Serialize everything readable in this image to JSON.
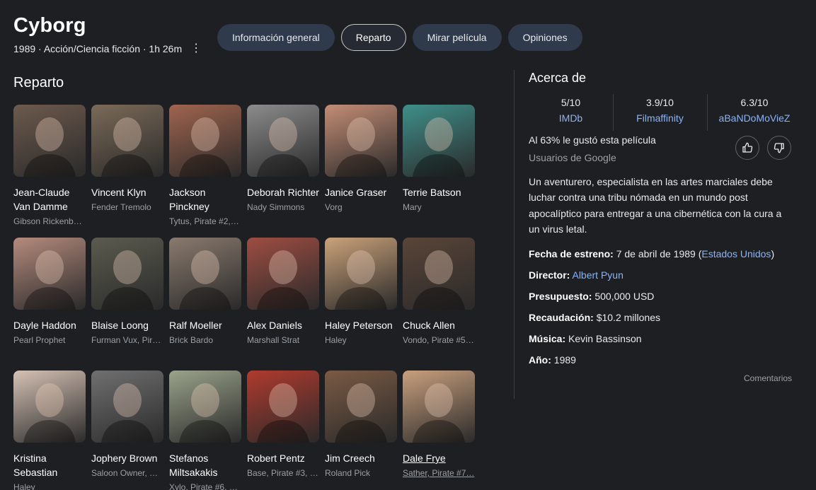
{
  "header": {
    "title": "Cyborg",
    "meta": "1989 · Acción/Ciencia ficción · 1h 26m"
  },
  "tabs": [
    {
      "label": "Información general",
      "active": false
    },
    {
      "label": "Reparto",
      "active": true
    },
    {
      "label": "Mirar película",
      "active": false
    },
    {
      "label": "Opiniones",
      "active": false
    }
  ],
  "cast": {
    "title": "Reparto",
    "items": [
      {
        "name": "Jean-Claude Van Damme",
        "role": "Gibson Rickenb…",
        "tone": "#6d5a4d"
      },
      {
        "name": "Vincent Klyn",
        "role": "Fender Tremolo",
        "tone": "#7b6a58"
      },
      {
        "name": "Jackson Pinckney",
        "role": "Tytus, Pirate #2,…",
        "tone": "#a0644e"
      },
      {
        "name": "Deborah Richter",
        "role": "Nady Simmons",
        "tone": "#8c8c8c"
      },
      {
        "name": "Janice Graser",
        "role": "Vorg",
        "tone": "#c48d76"
      },
      {
        "name": "Terrie Batson",
        "role": "Mary",
        "tone": "#3f8f8a"
      },
      {
        "name": "Dayle Haddon",
        "role": "Pearl Prophet",
        "tone": "#b58b7d"
      },
      {
        "name": "Blaise Loong",
        "role": "Furman Vux, Pir…",
        "tone": "#5b5b4f"
      },
      {
        "name": "Ralf Moeller",
        "role": "Brick Bardo",
        "tone": "#8a7a6e"
      },
      {
        "name": "Alex Daniels",
        "role": "Marshall Strat",
        "tone": "#9e4d42"
      },
      {
        "name": "Haley Peterson",
        "role": "Haley",
        "tone": "#caa27a"
      },
      {
        "name": "Chuck Allen",
        "role": "Vondo, Pirate #5…",
        "tone": "#5a4538"
      },
      {
        "name": "Kristina Sebastian",
        "role": "Haley",
        "tone": "#d6c2b5"
      },
      {
        "name": "Jophery Brown",
        "role": "Saloon Owner, …",
        "tone": "#707070"
      },
      {
        "name": "Stefanos Miltsakakis",
        "role": "Xylo, Pirate #6, …",
        "tone": "#9aa38b"
      },
      {
        "name": "Robert Pentz",
        "role": "Base, Pirate #3, …",
        "tone": "#b03a2e"
      },
      {
        "name": "Jim Creech",
        "role": "Roland Pick",
        "tone": "#7a5a44"
      },
      {
        "name": "Dale Frye",
        "role": "Sather, Pirate #7…",
        "tone": "#c9a07e"
      }
    ]
  },
  "about": {
    "title": "Acerca de",
    "ratings": [
      {
        "score": "5/10",
        "source": "IMDb"
      },
      {
        "score": "3.9/10",
        "source": "Filmaffinity"
      },
      {
        "score": "6.3/10",
        "source": "aBaNDoMoVieZ"
      }
    ],
    "liked": "Al 63% le gustó esta película",
    "liked_sub": "Usuarios de Google",
    "description": "Un aventurero, especialista en las artes marciales debe luchar contra una tribu nómada en un mundo post apocalíptico para entregar a una cibernética con la cura a un virus letal.",
    "facts": {
      "release_label": "Fecha de estreno:",
      "release_value": "7 de abril de 1989",
      "release_open": "(",
      "release_country": "Estados Unidos",
      "release_close": ")",
      "director_label": "Director:",
      "director_value": "Albert Pyun",
      "budget_label": "Presupuesto:",
      "budget_value": "500,000 USD",
      "gross_label": "Recaudación:",
      "gross_value": "$10.2 millones",
      "music_label": "Música:",
      "music_value": "Kevin Bassinson",
      "year_label": "Año:",
      "year_value": "1989"
    },
    "comments": "Comentarios"
  },
  "colors": {
    "link": "#8ab4f8",
    "tab_bg": "#2f3a4c"
  }
}
